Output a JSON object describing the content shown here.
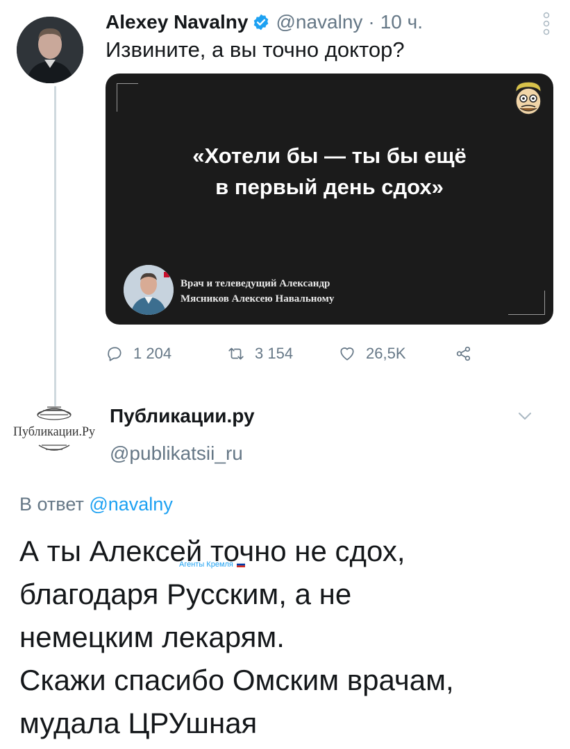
{
  "tweet": {
    "author_name": "Alexey Navalny",
    "author_handle": "@navalny",
    "meta_separator": "·",
    "time": "10 ч.",
    "text": "Извините, а вы точно доктор?",
    "quote_image": {
      "quote": "«Хотели бы — ты бы ещё\nв первый день сдох»",
      "caption": "Врач и телеведущий Александр\nМясников Алексею Навальному"
    },
    "actions": {
      "replies": "1 204",
      "retweets": "3 154",
      "likes": "26,5K"
    }
  },
  "reply_tweet": {
    "author_name": "Публикации.ру",
    "author_handle": "@publikatsii_ru",
    "avatar_logo_text": "Публикации.Ру",
    "reply_to_prefix": "В ответ",
    "reply_to_handle": "@navalny",
    "text": "А ты Алексей точно не сдох,\nблагодаря Русским, а не\nнемецким лекарям.\nСкажи спасибо Омским врачам,\nмудала ЦРУшная"
  },
  "watermark": {
    "text": "Агенты Кремля"
  },
  "colors": {
    "accent": "#1da1f2",
    "secondary_text": "#657786",
    "card_background": "#1b1b1b",
    "thread_line": "#cfd9de"
  }
}
